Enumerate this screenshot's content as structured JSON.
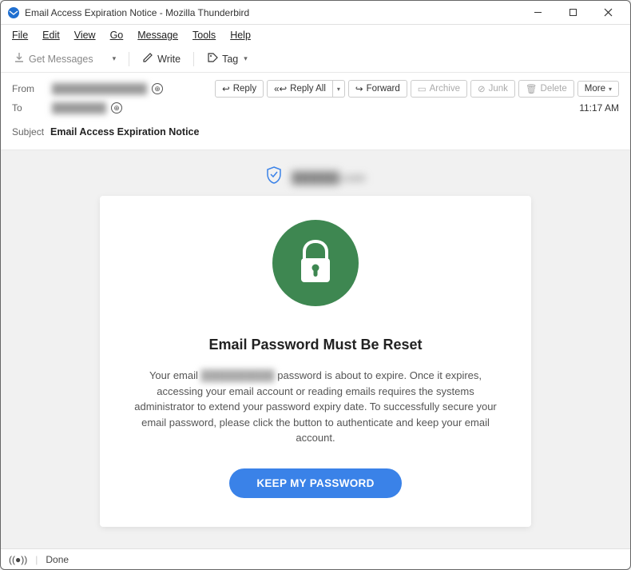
{
  "window": {
    "title": "Email Access Expiration Notice - Mozilla Thunderbird"
  },
  "menubar": {
    "file": "File",
    "edit": "Edit",
    "view": "View",
    "go": "Go",
    "message": "Message",
    "tools": "Tools",
    "help": "Help"
  },
  "toolbar": {
    "get_messages": "Get Messages",
    "write": "Write",
    "tag": "Tag"
  },
  "header": {
    "from_label": "From",
    "from_value": "██████████████",
    "to_label": "To",
    "to_value": "████████",
    "subject_label": "Subject",
    "subject_value": "Email Access Expiration Notice",
    "time": "11:17 AM"
  },
  "actions": {
    "reply": "Reply",
    "reply_all": "Reply All",
    "forward": "Forward",
    "archive": "Archive",
    "junk": "Junk",
    "delete": "Delete",
    "more": "More"
  },
  "email": {
    "verified_domain": "██████.com",
    "heading": "Email Password Must Be Reset",
    "body_pre": "Your email ",
    "body_blur": "██████████",
    "body_post": " password is about to expire. Once it expires, accessing your email account or reading emails requires  the systems administrator to extend your password expiry date. To successfully secure your email password, please click the button to authenticate and keep your email account.",
    "cta": "KEEP MY PASSWORD"
  },
  "statusbar": {
    "status": "Done"
  }
}
